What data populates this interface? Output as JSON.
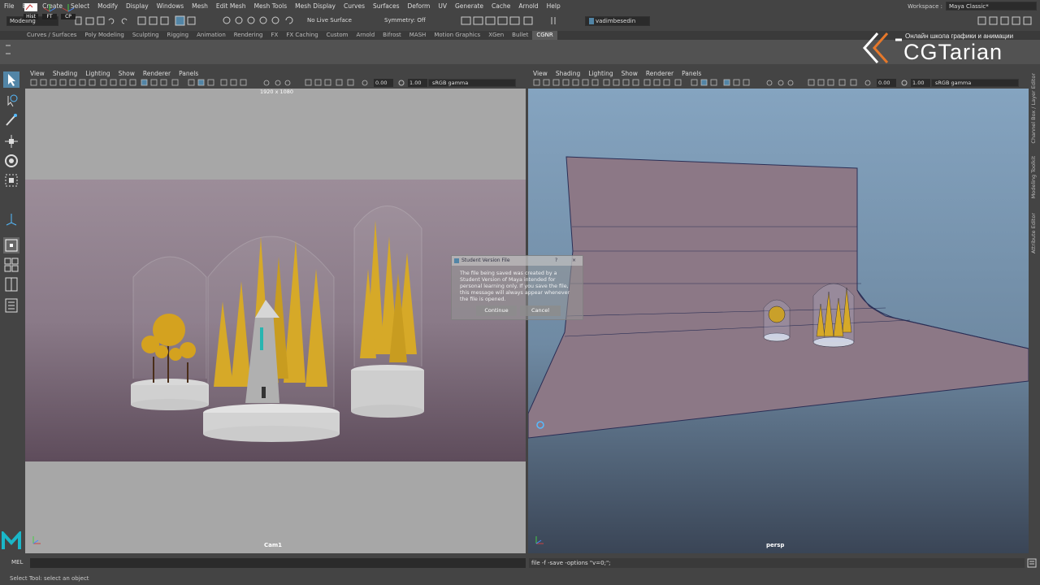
{
  "menubar": {
    "items": [
      "File",
      "Edit",
      "Create",
      "Select",
      "Modify",
      "Display",
      "Windows",
      "Mesh",
      "Edit Mesh",
      "Mesh Tools",
      "Mesh Display",
      "Curves",
      "Surfaces",
      "Deform",
      "UV",
      "Generate",
      "Cache",
      "Arnold",
      "Help"
    ],
    "workspace_label": "Workspace :",
    "workspace_value": "Maya Classic*"
  },
  "statusline": {
    "menuset": "Modeling",
    "live_surface": "No Live Surface",
    "symmetry": "Symmetry: Off",
    "user": "vadimbesedin"
  },
  "shelf": {
    "tabs": [
      "Curves / Surfaces",
      "Poly Modeling",
      "Sculpting",
      "Rigging",
      "Animation",
      "Rendering",
      "FX",
      "FX Caching",
      "Custom",
      "Arnold",
      "Bifrost",
      "MASH",
      "Motion Graphics",
      "XGen",
      "Bullet",
      "CGNR"
    ],
    "active_tab": "CGNR",
    "buttons": [
      "Hist",
      "FT",
      "CP"
    ]
  },
  "logo": {
    "tagline": "Онлайн школа графики и анимации",
    "brand": "CGTarian"
  },
  "viewport_left": {
    "menu": [
      "View",
      "Shading",
      "Lighting",
      "Show",
      "Renderer",
      "Panels"
    ],
    "field1": "0.00",
    "field2": "1.00",
    "color_space": "sRGB gamma",
    "resolution": "1920 x 1080",
    "camera": "Cam1"
  },
  "viewport_right": {
    "menu": [
      "View",
      "Shading",
      "Lighting",
      "Show",
      "Renderer",
      "Panels"
    ],
    "field1": "0.00",
    "field2": "1.00",
    "color_space": "sRGB gamma",
    "camera": "persp"
  },
  "right_sidebar": [
    "Channel Box / Layer Editor",
    "Modeling Toolkit",
    "Attribute Editor"
  ],
  "dialog": {
    "title": "Student Version File",
    "help": "?",
    "message": "The file being saved was created by a Student Version of Maya intended for personal learning only. If you save the file, this message will always appear whenever the file is opened.",
    "continue": "Continue",
    "cancel": "Cancel"
  },
  "commandline": {
    "lang": "MEL",
    "output": "file -f -save  -options \"v=0;\";"
  },
  "helpline": "Select Tool: select an object",
  "colors": {
    "accent": "#5285a6",
    "bg": "#444444"
  }
}
